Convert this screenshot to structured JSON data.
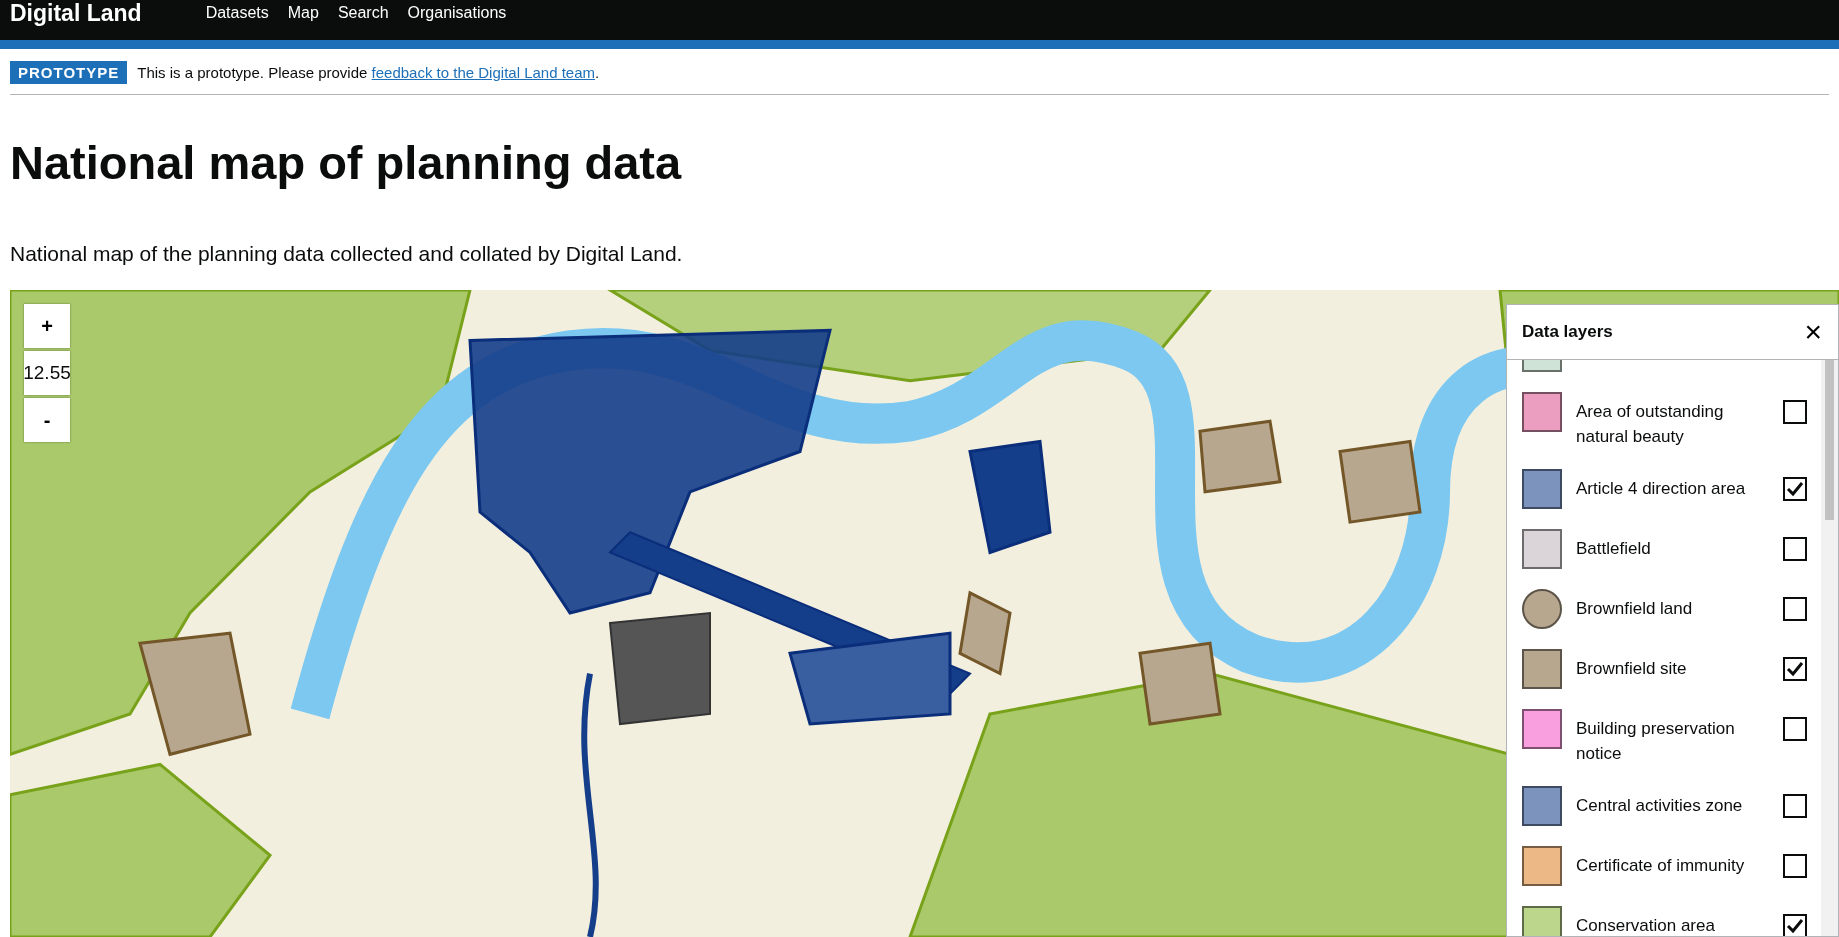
{
  "header": {
    "logo": "Digital Land",
    "nav": [
      {
        "label": "Datasets"
      },
      {
        "label": "Map"
      },
      {
        "label": "Search"
      },
      {
        "label": "Organisations"
      }
    ]
  },
  "banner": {
    "tag": "PROTOTYPE",
    "text": "This is a prototype. Please provide ",
    "link": "feedback to the Digital Land team",
    "after": "."
  },
  "title": "National map of planning data",
  "lead": "National map of the planning data collected and collated by Digital Land.",
  "map": {
    "zoom_in": "+",
    "zoom_level": "12.55",
    "zoom_out": "-"
  },
  "layers_panel": {
    "title": "Data layers",
    "close": "×",
    "layers": [
      {
        "kind": "square",
        "color": "#cfe3d6"
      },
      {
        "label": "Area of outstanding natural beauty",
        "kind": "square",
        "color": "#eb9ec0",
        "checked": false
      },
      {
        "label": "Article 4 direction area",
        "kind": "square",
        "color": "#7b93bd",
        "checked": true
      },
      {
        "label": "Battlefield",
        "kind": "square",
        "color": "#dbd5d9",
        "checked": false
      },
      {
        "label": "Brownfield land",
        "kind": "circle",
        "color": "#b8a78f",
        "checked": false
      },
      {
        "label": "Brownfield site",
        "kind": "square",
        "color": "#b8a78f",
        "checked": true
      },
      {
        "label": "Building preservation notice",
        "kind": "square",
        "color": "#f99fe0",
        "checked": false
      },
      {
        "label": "Central activities zone",
        "kind": "square",
        "color": "#7b93bd",
        "checked": false
      },
      {
        "label": "Certificate of immunity",
        "kind": "square",
        "color": "#ebb886",
        "checked": false
      },
      {
        "label": "Conservation area",
        "kind": "square",
        "color": "#bcd68c",
        "checked": true
      }
    ]
  }
}
